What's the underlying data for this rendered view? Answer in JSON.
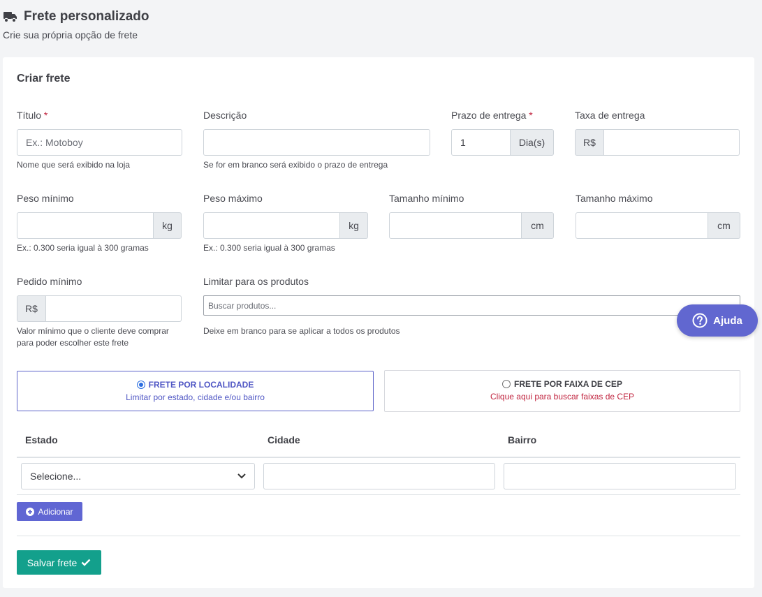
{
  "header": {
    "title": "Frete personalizado",
    "subtitle": "Crie sua própria opção de frete"
  },
  "card": {
    "title": "Criar frete"
  },
  "fields": {
    "titulo": {
      "label": "Título",
      "required": "*",
      "placeholder": "Ex.: Motoboy",
      "help": "Nome que será exibido na loja"
    },
    "descricao": {
      "label": "Descrição",
      "value": "",
      "help": "Se for em branco será exibido o prazo de entrega"
    },
    "prazo": {
      "label": "Prazo de entrega",
      "required": "*",
      "value": "1",
      "addon": "Dia(s)"
    },
    "taxa": {
      "label": "Taxa de entrega",
      "prefix": "R$",
      "value": ""
    },
    "peso_min": {
      "label": "Peso mínimo",
      "addon": "kg",
      "help": "Ex.: 0.300 seria igual à 300 gramas"
    },
    "peso_max": {
      "label": "Peso máximo",
      "addon": "kg",
      "help": "Ex.: 0.300 seria igual à 300 gramas"
    },
    "tam_min": {
      "label": "Tamanho mínimo",
      "addon": "cm"
    },
    "tam_max": {
      "label": "Tamanho máximo",
      "addon": "cm"
    },
    "pedido_min": {
      "label": "Pedido mínimo",
      "prefix": "R$",
      "help1": "Valor mínimo que o cliente deve comprar",
      "help2": "para poder escolher este frete"
    },
    "produtos": {
      "label": "Limitar para os produtos",
      "placeholder": "Buscar produtos...",
      "help": "Deixe em branco para se aplicar a todos os produtos"
    }
  },
  "options": [
    {
      "title": "FRETE POR LOCALIDADE",
      "subtitle": "Limitar por estado, cidade e/ou bairro",
      "selected": true,
      "title_color": "#4f56c4",
      "subtitle_color": "#4f56c4"
    },
    {
      "title": "FRETE POR FAIXA DE CEP",
      "subtitle": "Clique aqui para buscar faixas de CEP",
      "selected": false,
      "title_color": "#3f4046",
      "subtitle_color": "#c0233e"
    }
  ],
  "table": {
    "headers": [
      "Estado",
      "Cidade",
      "Bairro"
    ],
    "estado_selected": "Selecione...",
    "cidade_value": "",
    "bairro_value": ""
  },
  "buttons": {
    "add": "Adicionar",
    "save": "Salvar frete",
    "help": "Ajuda"
  },
  "colors": {
    "accent": "#6066d3",
    "save": "#13a08c",
    "required": "#c0233e"
  },
  "icons": {
    "title": "truck-icon",
    "add": "plus-circle-icon",
    "save": "check-icon",
    "help": "question-circle-icon"
  }
}
